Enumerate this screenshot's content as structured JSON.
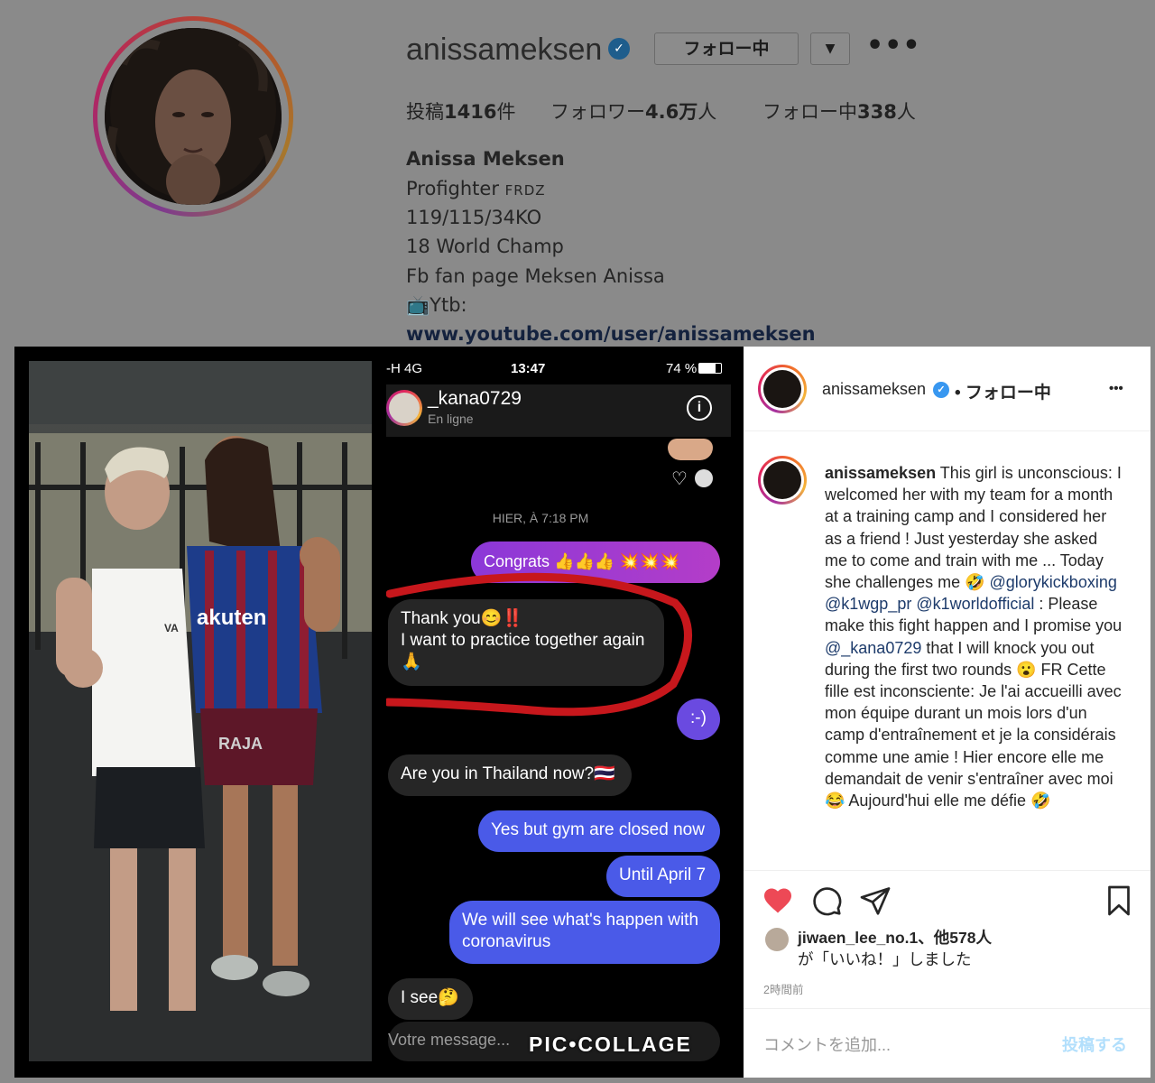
{
  "profile": {
    "username": "anissameksen",
    "follow_button": "フォロー中",
    "dropdown_icon": "▼",
    "more_icon": "•••",
    "stats": {
      "posts_label": "投稿",
      "posts_value": "1416",
      "posts_unit": "件",
      "followers_label": "フォロワー",
      "followers_value": "4.6万",
      "followers_unit": "人",
      "following_label": "フォロー中",
      "following_value": "338",
      "following_unit": "人"
    },
    "bio": {
      "full_name": "Anissa Meksen",
      "line1": "Profighter",
      "line1_flag": "FRDZ",
      "line2": "119/115/34KO",
      "line3": "18 World Champ",
      "line4": "Fb fan page Meksen Anissa",
      "line5_icon": "📺",
      "line5": "Ytb:",
      "link": "www.youtube.com/user/anissameksen"
    }
  },
  "photo": {
    "shirt_brand": "akuten",
    "shorts_text": "RAJA",
    "tank_logo": "VA"
  },
  "chat": {
    "status": {
      "carrier": "-H  4G",
      "time": "13:47",
      "battery": "74 %"
    },
    "contact_name": "_kana0729",
    "contact_status": "En ligne",
    "date_separator": "HIER, À 7:18 PM",
    "messages": [
      {
        "side": "out",
        "text": "Congrats 👍👍👍 💥💥💥"
      },
      {
        "side": "in",
        "text": "Thank you😊‼️"
      },
      {
        "side": "in",
        "text": "I want to practice together again"
      },
      {
        "side": "in",
        "text": "🙏"
      },
      {
        "side": "out",
        "text": ":-)"
      },
      {
        "side": "in",
        "text": "Are you in Thailand now?🇹🇭"
      },
      {
        "side": "out",
        "text": "Yes but gym are closed now"
      },
      {
        "side": "out",
        "text": "Until April 7"
      },
      {
        "side": "out",
        "text": "We will see what's happen with coronavirus"
      },
      {
        "side": "in",
        "text": "I see🤔"
      }
    ],
    "composer_placeholder": "Votre message...",
    "watermark": "PIC•COLLAGE"
  },
  "post": {
    "header_username": "anissameksen",
    "header_follow": "• フォロー中",
    "more_icon": "•••",
    "caption_username": "anissameksen",
    "caption_parts": [
      {
        "t": "text",
        "v": " This girl is unconscious: I welcomed her with my team for a month at a training camp and I considered her as a friend ! Just yesterday she asked me to come and train with me ... Today she challenges me 🤣 "
      },
      {
        "t": "tag",
        "v": "@glorykickboxing"
      },
      {
        "t": "text",
        "v": " "
      },
      {
        "t": "tag",
        "v": "@k1wgp_pr"
      },
      {
        "t": "text",
        "v": " "
      },
      {
        "t": "tag",
        "v": "@k1worldofficial"
      },
      {
        "t": "text",
        "v": " : Please make this fight happen and I promise you "
      },
      {
        "t": "tag",
        "v": "@_kana0729"
      },
      {
        "t": "text",
        "v": " that I will knock you out during the first two rounds 😮 FR Cette fille est inconsciente: Je l'ai accueilli avec mon équipe durant un mois lors d'un camp d'entraînement et je la considérais comme une amie ! Hier encore elle me demandait de venir s'entraîner avec moi 😂 Aujourd'hui elle me défie 🤣"
      }
    ],
    "likes_user": "jiwaen_lee_no.1",
    "likes_rest": "、他578人",
    "likes_suffix": "が「いいね！」しました",
    "time_ago": "2時間前",
    "comment_placeholder": "コメントを追加...",
    "post_button": "投稿する"
  }
}
